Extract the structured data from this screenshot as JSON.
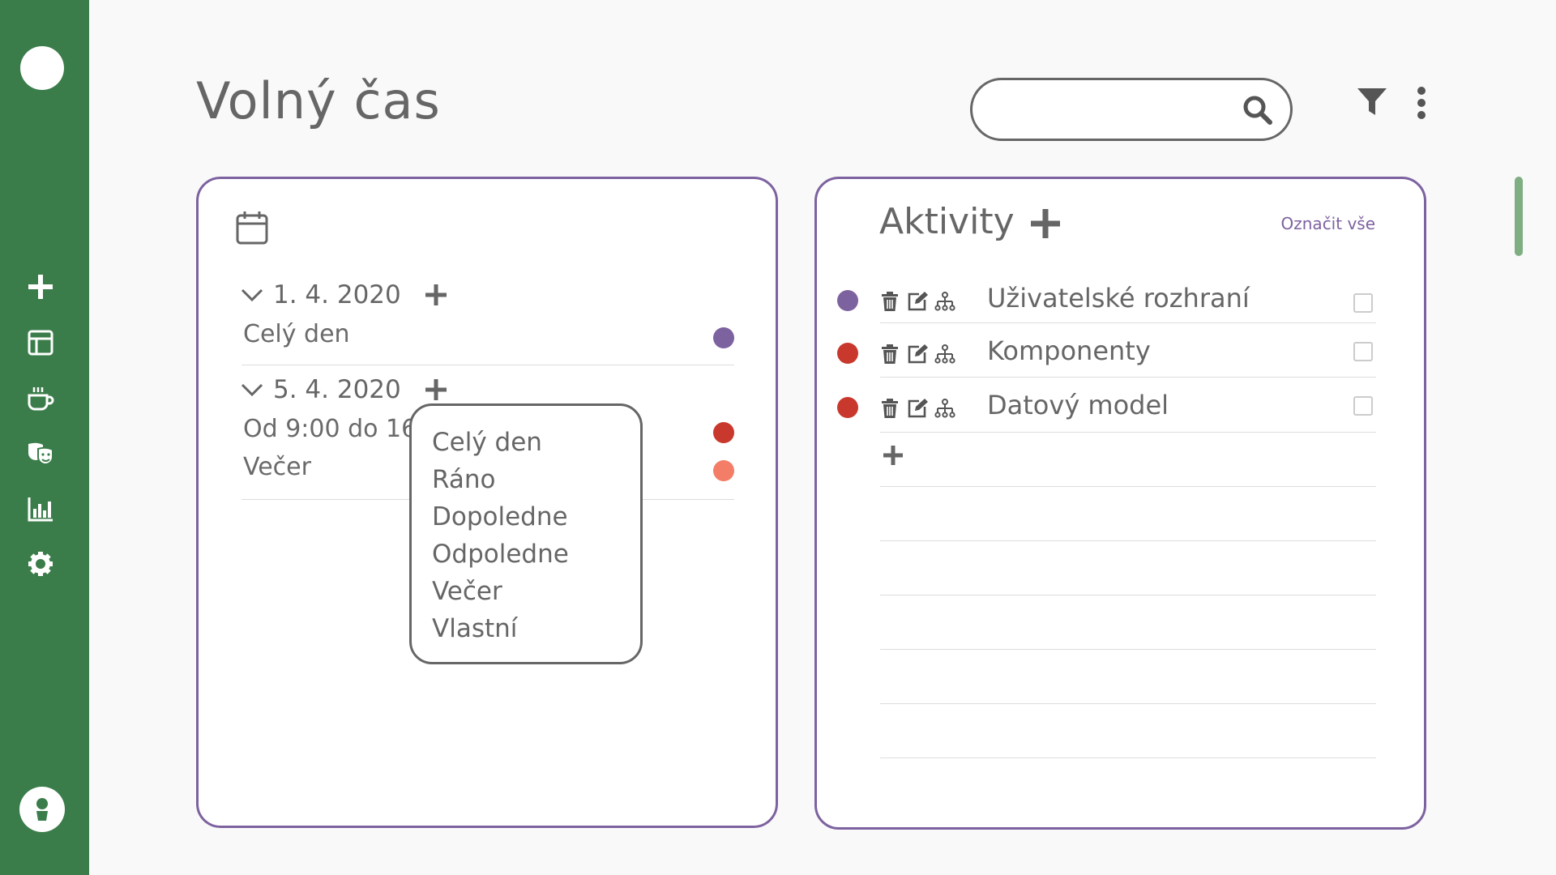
{
  "app": {
    "page_title": "Volný čas"
  },
  "colors": {
    "sidebar": "#3b7d4a",
    "card_border": "#7d62a0",
    "purple": "#7d62a0",
    "red": "#c8382d",
    "salmon": "#f47d67",
    "scroll_thumb": "#7fae82"
  },
  "sidebar": {
    "icons": [
      "plus-icon",
      "layout-icon",
      "coffee-icon",
      "theater-masks-icon",
      "bar-chart-icon",
      "settings-icon"
    ],
    "user_icon": "user-icon"
  },
  "search": {
    "value": "",
    "placeholder": ""
  },
  "calendar": {
    "days": [
      {
        "date": "1. 4. 2020",
        "entries": [
          {
            "label": "Celý den",
            "color": "#7d62a0"
          }
        ]
      },
      {
        "date": "5. 4. 2020",
        "entries": [
          {
            "label": "Od 9:00 do 16:",
            "color": "#c8382d"
          },
          {
            "label": "Večer",
            "color": "#f47d67"
          }
        ]
      }
    ]
  },
  "dropdown": {
    "options": [
      "Celý den",
      "Ráno",
      "Dopoledne",
      "Odpoledne",
      "Večer",
      "Vlastní"
    ]
  },
  "activities": {
    "title": "Aktivity",
    "mark_all": "Označit vše",
    "items": [
      {
        "label": "Uživatelské rozhraní",
        "color": "#7d62a0",
        "checked": false
      },
      {
        "label": "Komponenty",
        "color": "#c8382d",
        "checked": false
      },
      {
        "label": "Datový model",
        "color": "#c8382d",
        "checked": false
      }
    ]
  }
}
